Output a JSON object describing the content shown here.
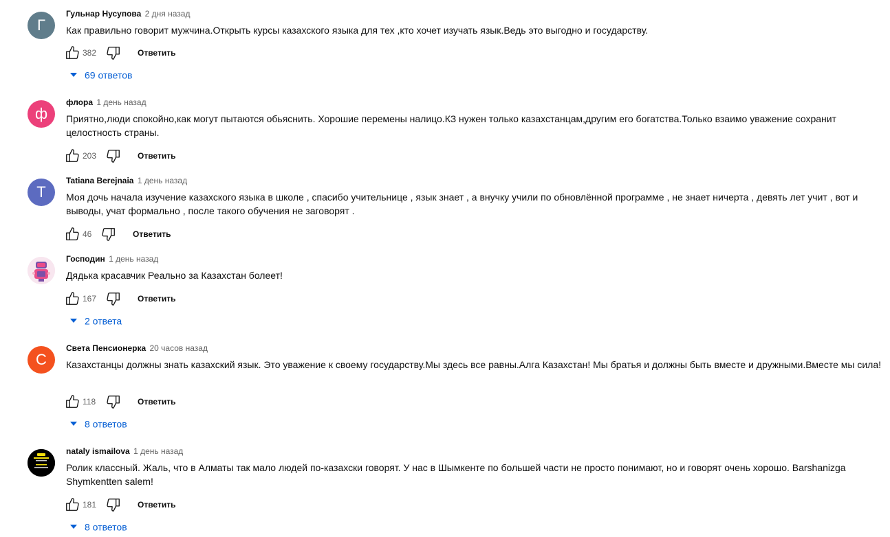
{
  "comments": [
    {
      "author": "Гульнар Нусупова",
      "time": "2 дня назад",
      "avatar_letter": "Г",
      "avatar_color": "#607d8b",
      "text": "Как правильно говорит мужчина.Открыть курсы казахского языка для тех ,кто хочет изучать язык.Ведь это выгодно и государству.",
      "likes": "382",
      "reply_label": "Ответить",
      "replies_label": "69 ответов"
    },
    {
      "author": "флора",
      "time": "1 день назад",
      "avatar_letter": "ф",
      "avatar_color": "#ec407a",
      "text": "Приятно,люди спокойно,как могут пытаются обьяснить. Хорошие перемены налицо.КЗ нужен только казахстанцам,другим его богатства.Только взаимо уважение сохранит целостность страны.",
      "likes": "203",
      "reply_label": "Ответить"
    },
    {
      "author": "Tatiana Berejnaia",
      "time": "1 день назад",
      "avatar_letter": "T",
      "avatar_color": "#5c6bc0",
      "text": "Моя дочь начала изучение казахского языка в школе , спасибо учительнице , язык знает , а внучку учили по обновлённой программе , не знает ничерта , девять лет учит , вот и выводы, учат формально , после такого обучения не заговорят .",
      "likes": "46",
      "reply_label": "Ответить"
    },
    {
      "author": "Господин",
      "time": "1 день назад",
      "avatar_letter": "",
      "avatar_color": "#f3e5f5",
      "text": "Дядька красавчик Реально за Казахстан болеет!",
      "likes": "167",
      "reply_label": "Ответить",
      "replies_label": "2 ответа"
    },
    {
      "author": "Света Пенсионерка",
      "time": "20 часов назад",
      "avatar_letter": "С",
      "avatar_color": "#f4511e",
      "text": "Казахстанцы должны знать казахский язык. Это уважение к своему государству.Мы здесь все равны.Алга Казахстан! Мы братья и должны  быть вместе и дружными.Вместе мы сила!",
      "likes": "118",
      "reply_label": "Ответить",
      "replies_label": "8 ответов"
    },
    {
      "author": "nataly ismailova",
      "time": "1 день назад",
      "avatar_letter": "",
      "avatar_color": "#000000",
      "text": "Ролик классный. Жаль, что в Алматы так мало людей по-казахски говорят. У нас в Шымкенте по большей части не просто понимают, но и говорят очень хорошо. Barshanizga Shymkentten salem!",
      "likes": "181",
      "reply_label": "Ответить",
      "replies_label": "8 ответов"
    }
  ],
  "icons": {
    "like": "thumb-up-icon",
    "dislike": "thumb-down-icon",
    "expand": "chevron-down-icon"
  },
  "colors": {
    "link": "#065fd4",
    "secondary_text": "#606060"
  }
}
